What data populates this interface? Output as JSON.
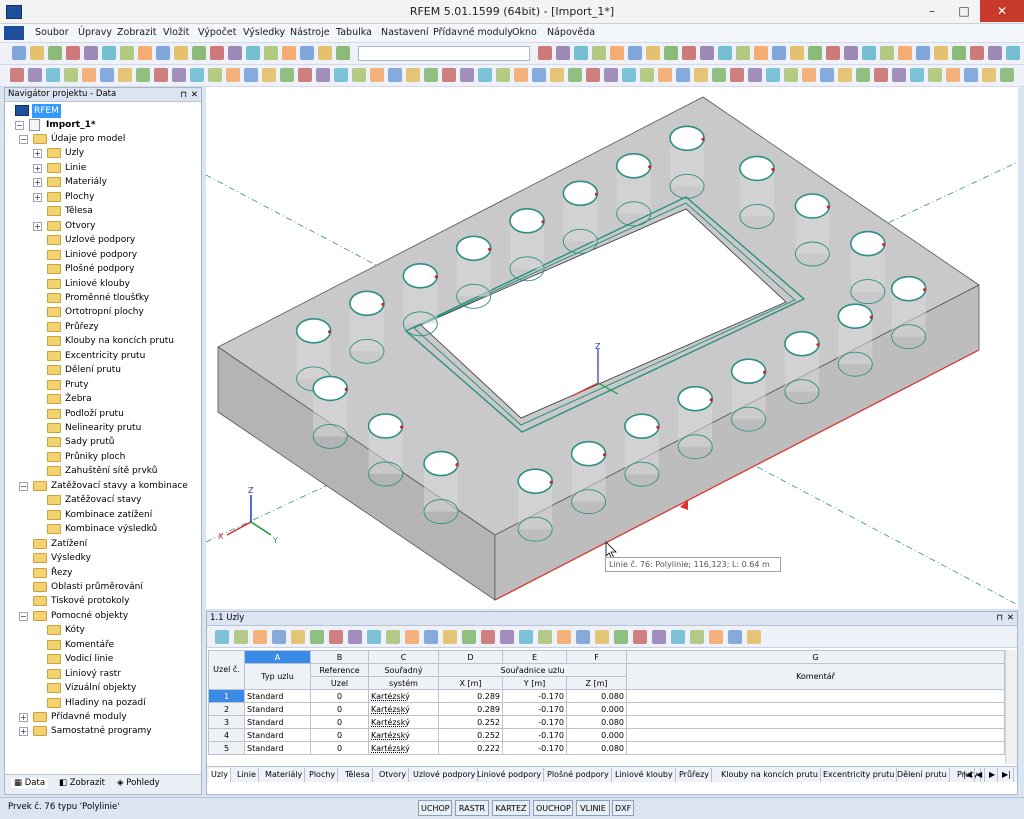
{
  "window": {
    "title": "RFEM 5.01.1599 (64bit) - [Import_1*]"
  },
  "menu": [
    "Soubor",
    "Úpravy",
    "Zobrazit",
    "Vložit",
    "Výpočet",
    "Výsledky",
    "Nástroje",
    "Tabulka",
    "Nastavení",
    "Přídavné moduly",
    "Okno",
    "Nápověda"
  ],
  "navigator": {
    "title": "Navigátor projektu - Data",
    "root": "RFEM",
    "project": "Import_1*",
    "items": [
      {
        "label": "Údaje pro model",
        "level": 2,
        "exp": "-"
      },
      {
        "label": "Uzly",
        "level": 3,
        "exp": "+"
      },
      {
        "label": "Linie",
        "level": 3,
        "exp": "+"
      },
      {
        "label": "Materiály",
        "level": 3,
        "exp": "+"
      },
      {
        "label": "Plochy",
        "level": 3,
        "exp": "+"
      },
      {
        "label": "Tělesa",
        "level": 3,
        "exp": ""
      },
      {
        "label": "Otvory",
        "level": 3,
        "exp": "+"
      },
      {
        "label": "Uzlové podpory",
        "level": 3,
        "exp": ""
      },
      {
        "label": "Liniové podpory",
        "level": 3,
        "exp": ""
      },
      {
        "label": "Plošné podpory",
        "level": 3,
        "exp": ""
      },
      {
        "label": "Liniové klouby",
        "level": 3,
        "exp": ""
      },
      {
        "label": "Proměnné tloušťky",
        "level": 3,
        "exp": ""
      },
      {
        "label": "Ortotropní plochy",
        "level": 3,
        "exp": ""
      },
      {
        "label": "Průřezy",
        "level": 3,
        "exp": ""
      },
      {
        "label": "Klouby na koncích prutu",
        "level": 3,
        "exp": ""
      },
      {
        "label": "Excentricity prutu",
        "level": 3,
        "exp": ""
      },
      {
        "label": "Dělení prutu",
        "level": 3,
        "exp": ""
      },
      {
        "label": "Pruty",
        "level": 3,
        "exp": ""
      },
      {
        "label": "Žebra",
        "level": 3,
        "exp": ""
      },
      {
        "label": "Podloží prutu",
        "level": 3,
        "exp": ""
      },
      {
        "label": "Nelinearity prutu",
        "level": 3,
        "exp": ""
      },
      {
        "label": "Sady prutů",
        "level": 3,
        "exp": ""
      },
      {
        "label": "Průniky ploch",
        "level": 3,
        "exp": ""
      },
      {
        "label": "Zahuštění sítě prvků",
        "level": 3,
        "exp": ""
      },
      {
        "label": "Zatěžovací stavy a kombinace",
        "level": 2,
        "exp": "-"
      },
      {
        "label": "Zatěžovací stavy",
        "level": 3,
        "exp": ""
      },
      {
        "label": "Kombinace zatížení",
        "level": 3,
        "exp": ""
      },
      {
        "label": "Kombinace výsledků",
        "level": 3,
        "exp": ""
      },
      {
        "label": "Zatížení",
        "level": 2,
        "exp": ""
      },
      {
        "label": "Výsledky",
        "level": 2,
        "exp": ""
      },
      {
        "label": "Řezy",
        "level": 2,
        "exp": ""
      },
      {
        "label": "Oblasti průměrování",
        "level": 2,
        "exp": ""
      },
      {
        "label": "Tiskové protokoly",
        "level": 2,
        "exp": ""
      },
      {
        "label": "Pomocné objekty",
        "level": 2,
        "exp": "-"
      },
      {
        "label": "Kóty",
        "level": 3,
        "exp": ""
      },
      {
        "label": "Komentáře",
        "level": 3,
        "exp": ""
      },
      {
        "label": "Vodicí linie",
        "level": 3,
        "exp": ""
      },
      {
        "label": "Liniový rastr",
        "level": 3,
        "exp": ""
      },
      {
        "label": "Vizuální objekty",
        "level": 3,
        "exp": ""
      },
      {
        "label": "Hladiny na pozadí",
        "level": 3,
        "exp": ""
      },
      {
        "label": "Přídavné moduly",
        "level": 2,
        "exp": "+"
      },
      {
        "label": "Samostatné programy",
        "level": 2,
        "exp": "+"
      }
    ],
    "tabs": [
      "Data",
      "Zobrazit",
      "Pohledy"
    ]
  },
  "viewport": {
    "tooltip": "Linie č. 76: Polylinie; 116,123; L: 0.64 m",
    "axis_labels": {
      "x": "X",
      "y": "Y",
      "z": "Z"
    }
  },
  "table": {
    "title": "1.1 Uzly",
    "col_letters": [
      "A",
      "B",
      "C",
      "D",
      "E",
      "F",
      "G"
    ],
    "headers": {
      "row_header": "Uzel č.",
      "typ": "Typ uzlu",
      "ref_top": "Reference",
      "ref_bot": "Uzel",
      "sys_top": "Souřadný",
      "sys_bot": "systém",
      "coord_top": "Souřadnice uzlu",
      "x": "X [m]",
      "y": "Y [m]",
      "z": "Z [m]",
      "comment": "Komentář"
    },
    "rows": [
      {
        "no": "1",
        "typ": "Standard",
        "ref": "0",
        "sys": "Kartézský",
        "x": "0.289",
        "y": "-0.170",
        "z": "0.080",
        "comment": ""
      },
      {
        "no": "2",
        "typ": "Standard",
        "ref": "0",
        "sys": "Kartézský",
        "x": "0.289",
        "y": "-0.170",
        "z": "0.000",
        "comment": ""
      },
      {
        "no": "3",
        "typ": "Standard",
        "ref": "0",
        "sys": "Kartézský",
        "x": "0.252",
        "y": "-0.170",
        "z": "0.080",
        "comment": ""
      },
      {
        "no": "4",
        "typ": "Standard",
        "ref": "0",
        "sys": "Kartézský",
        "x": "0.252",
        "y": "-0.170",
        "z": "0.000",
        "comment": ""
      },
      {
        "no": "5",
        "typ": "Standard",
        "ref": "0",
        "sys": "Kartézský",
        "x": "0.222",
        "y": "-0.170",
        "z": "0.080",
        "comment": ""
      }
    ],
    "sheet_tabs": [
      "Uzly",
      "Linie",
      "Materiály",
      "Plochy",
      "Tělesa",
      "Otvory",
      "Uzlové podpory",
      "Liniové podpory",
      "Plošné podpory",
      "Liniové klouby",
      "Průřezy",
      "Klouby na koncích prutu",
      "Excentricity prutu",
      "Dělení prutu",
      "Pruty"
    ]
  },
  "status": {
    "text": "Prvek č. 76 typu 'Polylinie'",
    "buttons": [
      "UCHOP",
      "RASTR",
      "KARTEZ",
      "OUCHOP",
      "VLINIE",
      "DXF"
    ]
  }
}
